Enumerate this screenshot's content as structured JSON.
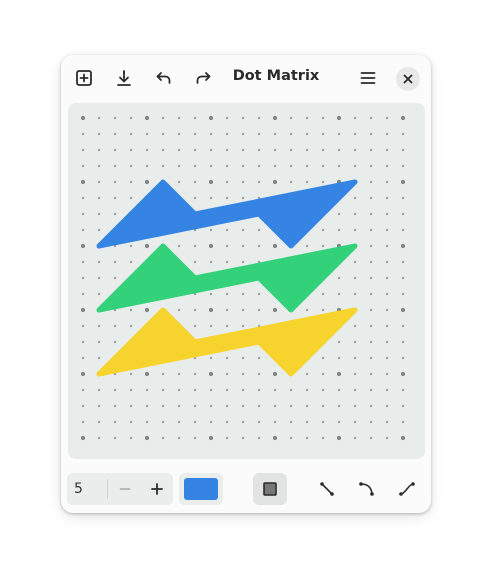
{
  "window": {
    "title": "Dot Matrix"
  },
  "header": {
    "new_icon": "plus-square-icon",
    "save_icon": "download-icon",
    "undo_icon": "undo-icon",
    "redo_icon": "redo-icon",
    "menu_icon": "hamburger-menu-icon",
    "close_icon": "close-icon"
  },
  "canvas": {
    "grid": {
      "columns": 21,
      "rows": 21,
      "major_every": 4
    },
    "colors": {
      "background": "#e8edeb",
      "dot": "#9aa09e",
      "major_dot": "#7d8482"
    },
    "shapes": [
      {
        "name": "blue-zigzag",
        "color": "#3584e4",
        "points": [
          [
            1,
            8
          ],
          [
            5,
            4
          ],
          [
            7,
            6
          ],
          [
            17,
            4
          ],
          [
            13,
            8
          ],
          [
            11,
            6
          ]
        ]
      },
      {
        "name": "green-zigzag",
        "color": "#33d17a",
        "points": [
          [
            1,
            12
          ],
          [
            5,
            8
          ],
          [
            7,
            10
          ],
          [
            17,
            8
          ],
          [
            13,
            12
          ],
          [
            11,
            10
          ]
        ]
      },
      {
        "name": "yellow-zigzag",
        "color": "#f6d32d",
        "points": [
          [
            1,
            16
          ],
          [
            5,
            12
          ],
          [
            7,
            14
          ],
          [
            17,
            12
          ],
          [
            13,
            16
          ],
          [
            11,
            14
          ]
        ]
      }
    ]
  },
  "toolbar": {
    "stroke_width": "5",
    "minus_label": "−",
    "plus_label": "+",
    "selected_color": "#3584e4",
    "fill_color": "#777777",
    "tools": [
      "line-tool-icon",
      "curve-tool-icon",
      "s-curve-tool-icon"
    ]
  }
}
